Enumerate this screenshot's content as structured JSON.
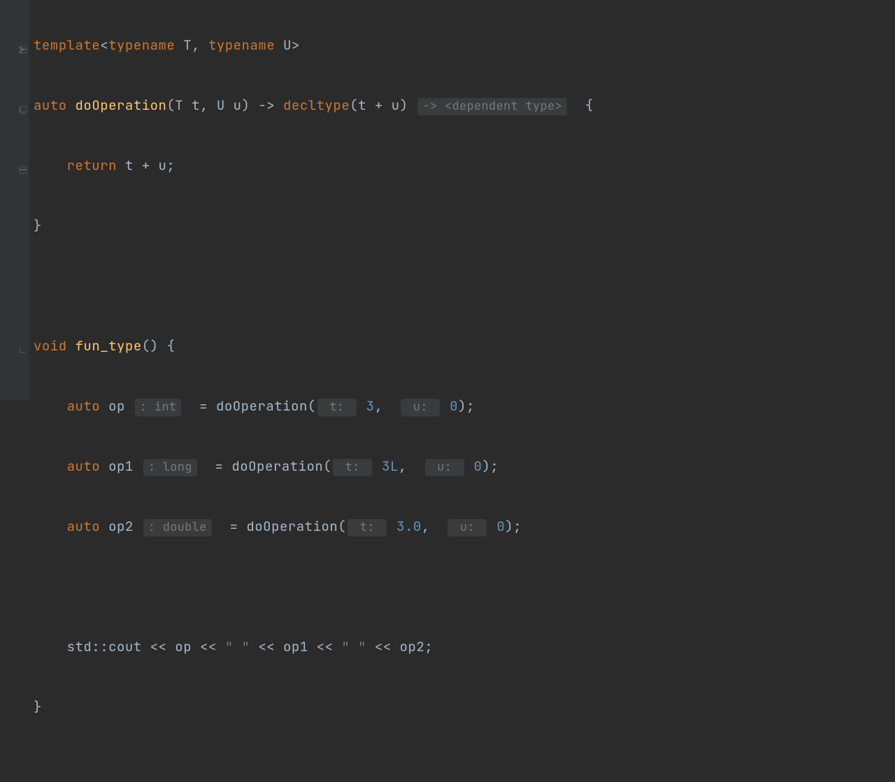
{
  "code": {
    "l1": {
      "kw1": "template",
      "punc1": "<",
      "kw2": "typename",
      "id1": " T",
      "punc2": ", ",
      "kw3": "typename",
      "id2": " U",
      "punc3": ">"
    },
    "l2": {
      "kw1": "auto",
      "fn": "doOperation",
      "params": "(T t, U u) ",
      "arrow": "-> ",
      "kw2": "decltype",
      "args": "(t + u)",
      "hint": "-> <dependent type>",
      "brace": "  {"
    },
    "l3": {
      "kw": "return",
      "expr": " t + u;"
    },
    "l4": {
      "brace": "}"
    },
    "l6": {
      "kw": "void",
      "fn": "fun_type",
      "rest": "() {"
    },
    "l7": {
      "kw": "auto",
      "var": " op ",
      "hint": ": int",
      "eq": "  = ",
      "fn": "doOperation",
      "open": "(",
      "p1": " t: ",
      "n1": "3",
      "c1": ",  ",
      "p2": " u: ",
      "n2": "0",
      "close": ");"
    },
    "l8": {
      "kw": "auto",
      "var": " op1 ",
      "hint": ": long",
      "eq": "  = ",
      "fn": "doOperation",
      "open": "(",
      "p1": " t: ",
      "n1": "3L",
      "c1": ",  ",
      "p2": " u: ",
      "n2": "0",
      "close": ");"
    },
    "l9": {
      "kw": "auto",
      "var": " op2 ",
      "hint": ": double",
      "eq": "  = ",
      "fn": "doOperation",
      "open": "(",
      "p1": " t: ",
      "n1": "3.0",
      "c1": ",  ",
      "p2": " u: ",
      "n2": "0",
      "close": ");"
    },
    "l11": {
      "std": "std::cout << op << ",
      "s1": "\" \"",
      "mid1": " << op1 << ",
      "s2": "\" \"",
      "mid2": " << op2;"
    },
    "l12": {
      "brace": "}"
    }
  },
  "gutter": {
    "fold_open": "−",
    "fold_close": "−"
  }
}
